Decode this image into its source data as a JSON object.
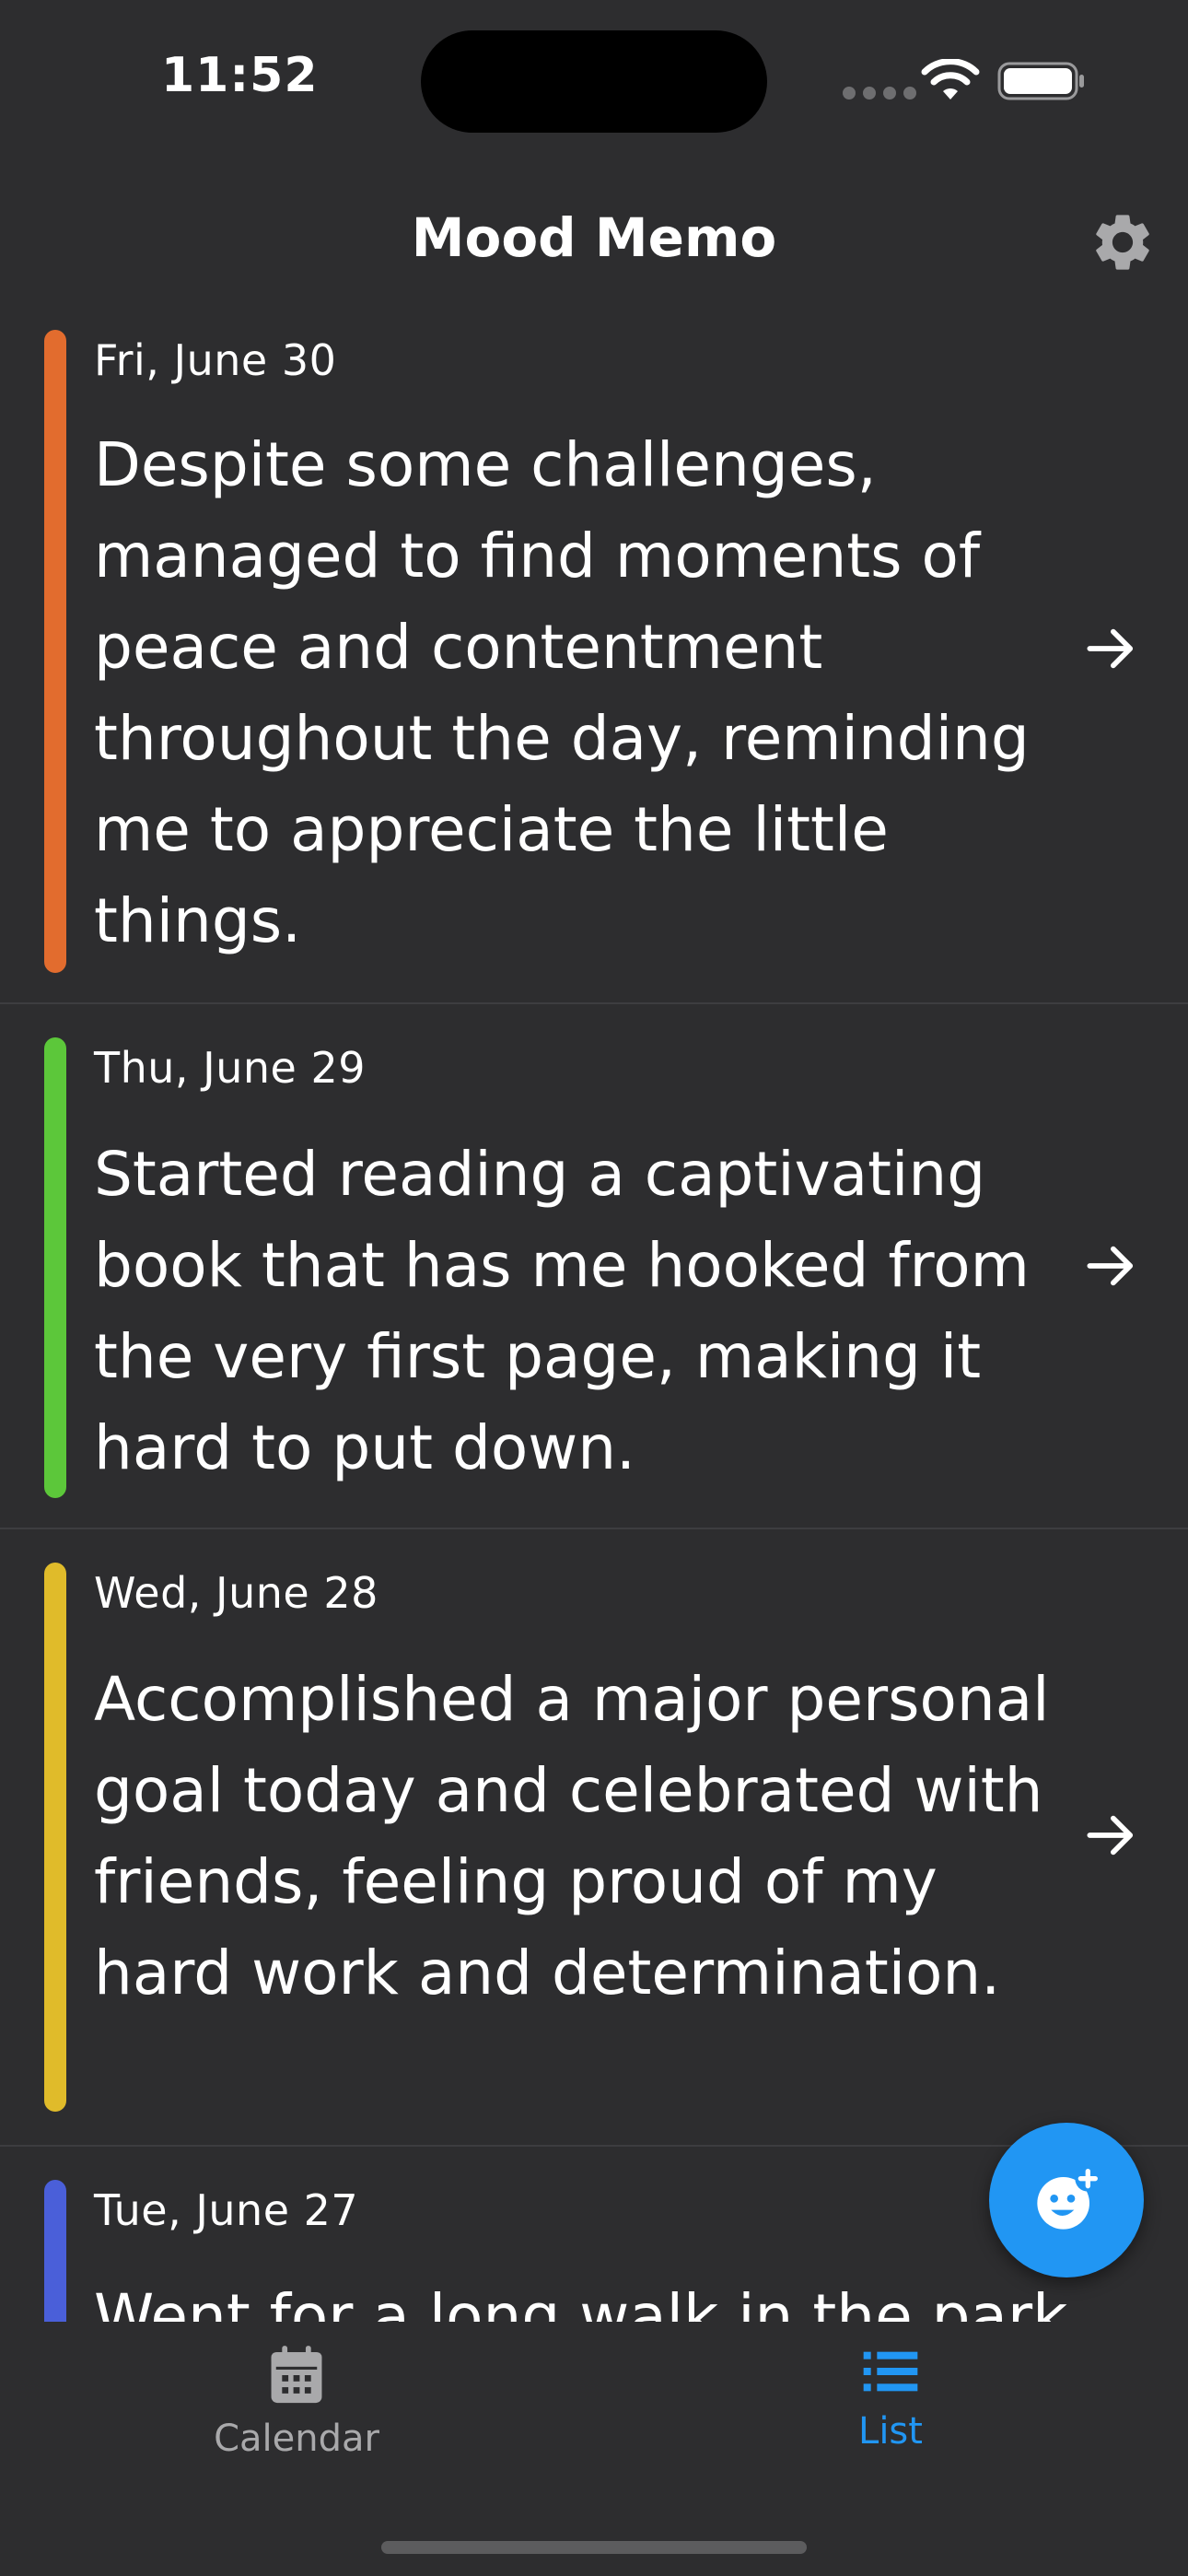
{
  "status_bar": {
    "time": "11:52"
  },
  "header": {
    "title": "Mood Memo",
    "settings_icon": "gear-icon"
  },
  "entries": [
    {
      "date": "Fri, June 30",
      "text": "Despite some challenges, managed to find moments of peace and contentment throughout the day, reminding me to appreciate the little things.",
      "mood_color": "#e26c2e"
    },
    {
      "date": "Thu, June 29",
      "text": "Started reading a captivating book that has me hooked from the very first page, making it hard to put down.",
      "mood_color": "#5cc73a"
    },
    {
      "date": "Wed, June 28",
      "text": "Accomplished a major personal goal today and celebrated with friends, feeling proud of my hard work and determination.",
      "mood_color": "#e0bb2a"
    },
    {
      "date": "Tue, June 27",
      "text": "Went for a long walk in the park",
      "mood_color": "#4a5fd9"
    }
  ],
  "fab": {
    "icon": "add-mood-icon"
  },
  "bottom_nav": {
    "calendar_label": "Calendar",
    "list_label": "List",
    "active_color": "#2196f3",
    "inactive_color": "#a9a9ab"
  }
}
